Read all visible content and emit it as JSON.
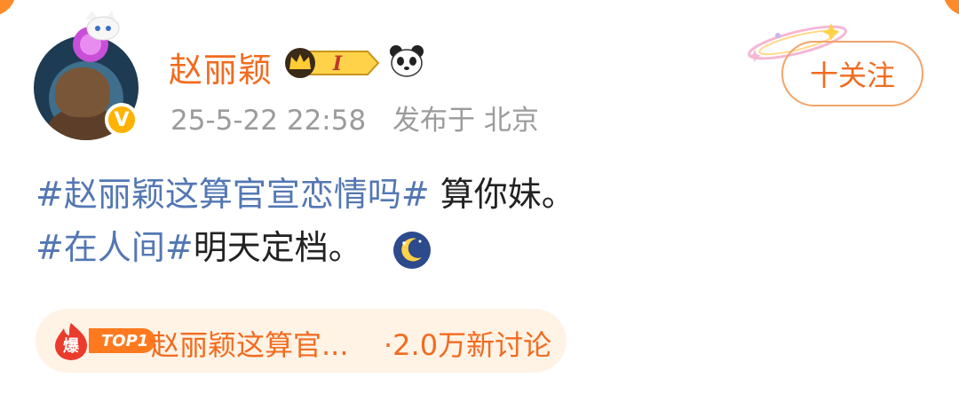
{
  "post": {
    "username": "赵丽颖",
    "level_badge": "I",
    "timestamp": "25-5-22 22:58",
    "location": "发布于 北京",
    "follow_label": "十关注",
    "text": {
      "line1_tag": "#赵丽颖这算官宣恋情吗#",
      "line1_rest": " 算你妹。",
      "line2_tag": "#在人间#",
      "line2_rest": "明天定档。"
    }
  },
  "hot_search": {
    "icon_label": "爆",
    "rank": "TOP1",
    "title": "赵丽颖这算官...",
    "count": "·2.0万新讨论"
  },
  "colors": {
    "accent": "#f26b1f",
    "tag": "#5377b3",
    "meta": "#9b9b9b",
    "hot_bg": "#fff3e6"
  },
  "icons": [
    "crown-icon",
    "panda-icon",
    "verified-icon",
    "moon-emoji-icon",
    "explosion-icon",
    "sparkle-icon"
  ]
}
